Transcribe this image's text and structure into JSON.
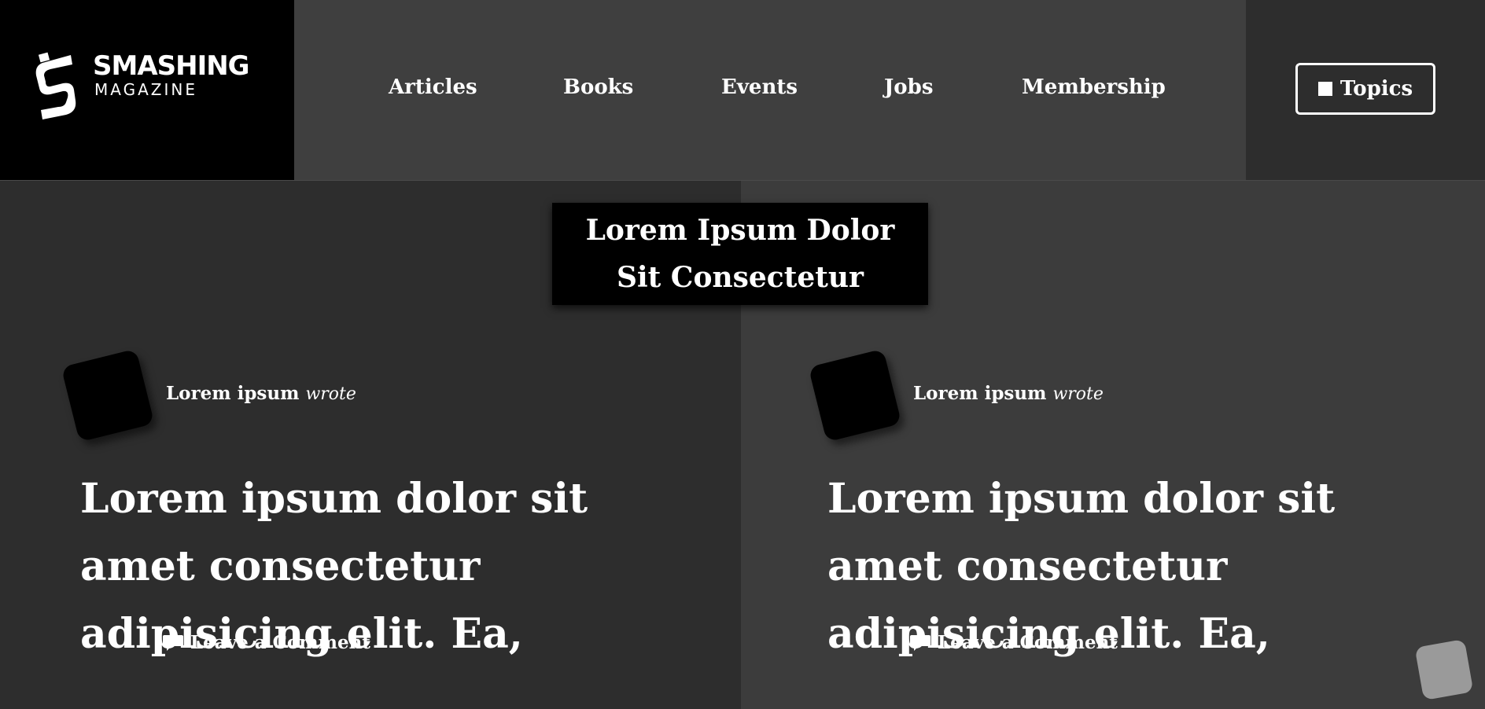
{
  "brand": {
    "word1": "SMASHING",
    "word2": "MAGAZINE"
  },
  "nav": {
    "items": [
      {
        "label": "Articles"
      },
      {
        "label": "Books"
      },
      {
        "label": "Events"
      },
      {
        "label": "Jobs"
      },
      {
        "label": "Membership"
      }
    ],
    "topics_label": "Topics"
  },
  "hero": {
    "title": "Lorem Ipsum Dolor Sit Consectetur"
  },
  "posts": [
    {
      "author": "Lorem ipsum",
      "verb": "wrote",
      "title": "Lorem ipsum dolor sit amet consectetur adipisicing elit. Ea,",
      "comment_label": "Leave a Comment"
    },
    {
      "author": "Lorem ipsum",
      "verb": "wrote",
      "title": "Lorem ipsum dolor sit amet consectetur adipisicing elit. Ea,",
      "comment_label": "Leave a Comment"
    }
  ],
  "colors": {
    "logo_bg": "#000000",
    "nav_bg": "#3f3f3f",
    "topics_bg": "#2d2d2d",
    "panel_left": "#2d2d2d",
    "panel_right": "#3c3c3c",
    "text": "#ffffff"
  }
}
